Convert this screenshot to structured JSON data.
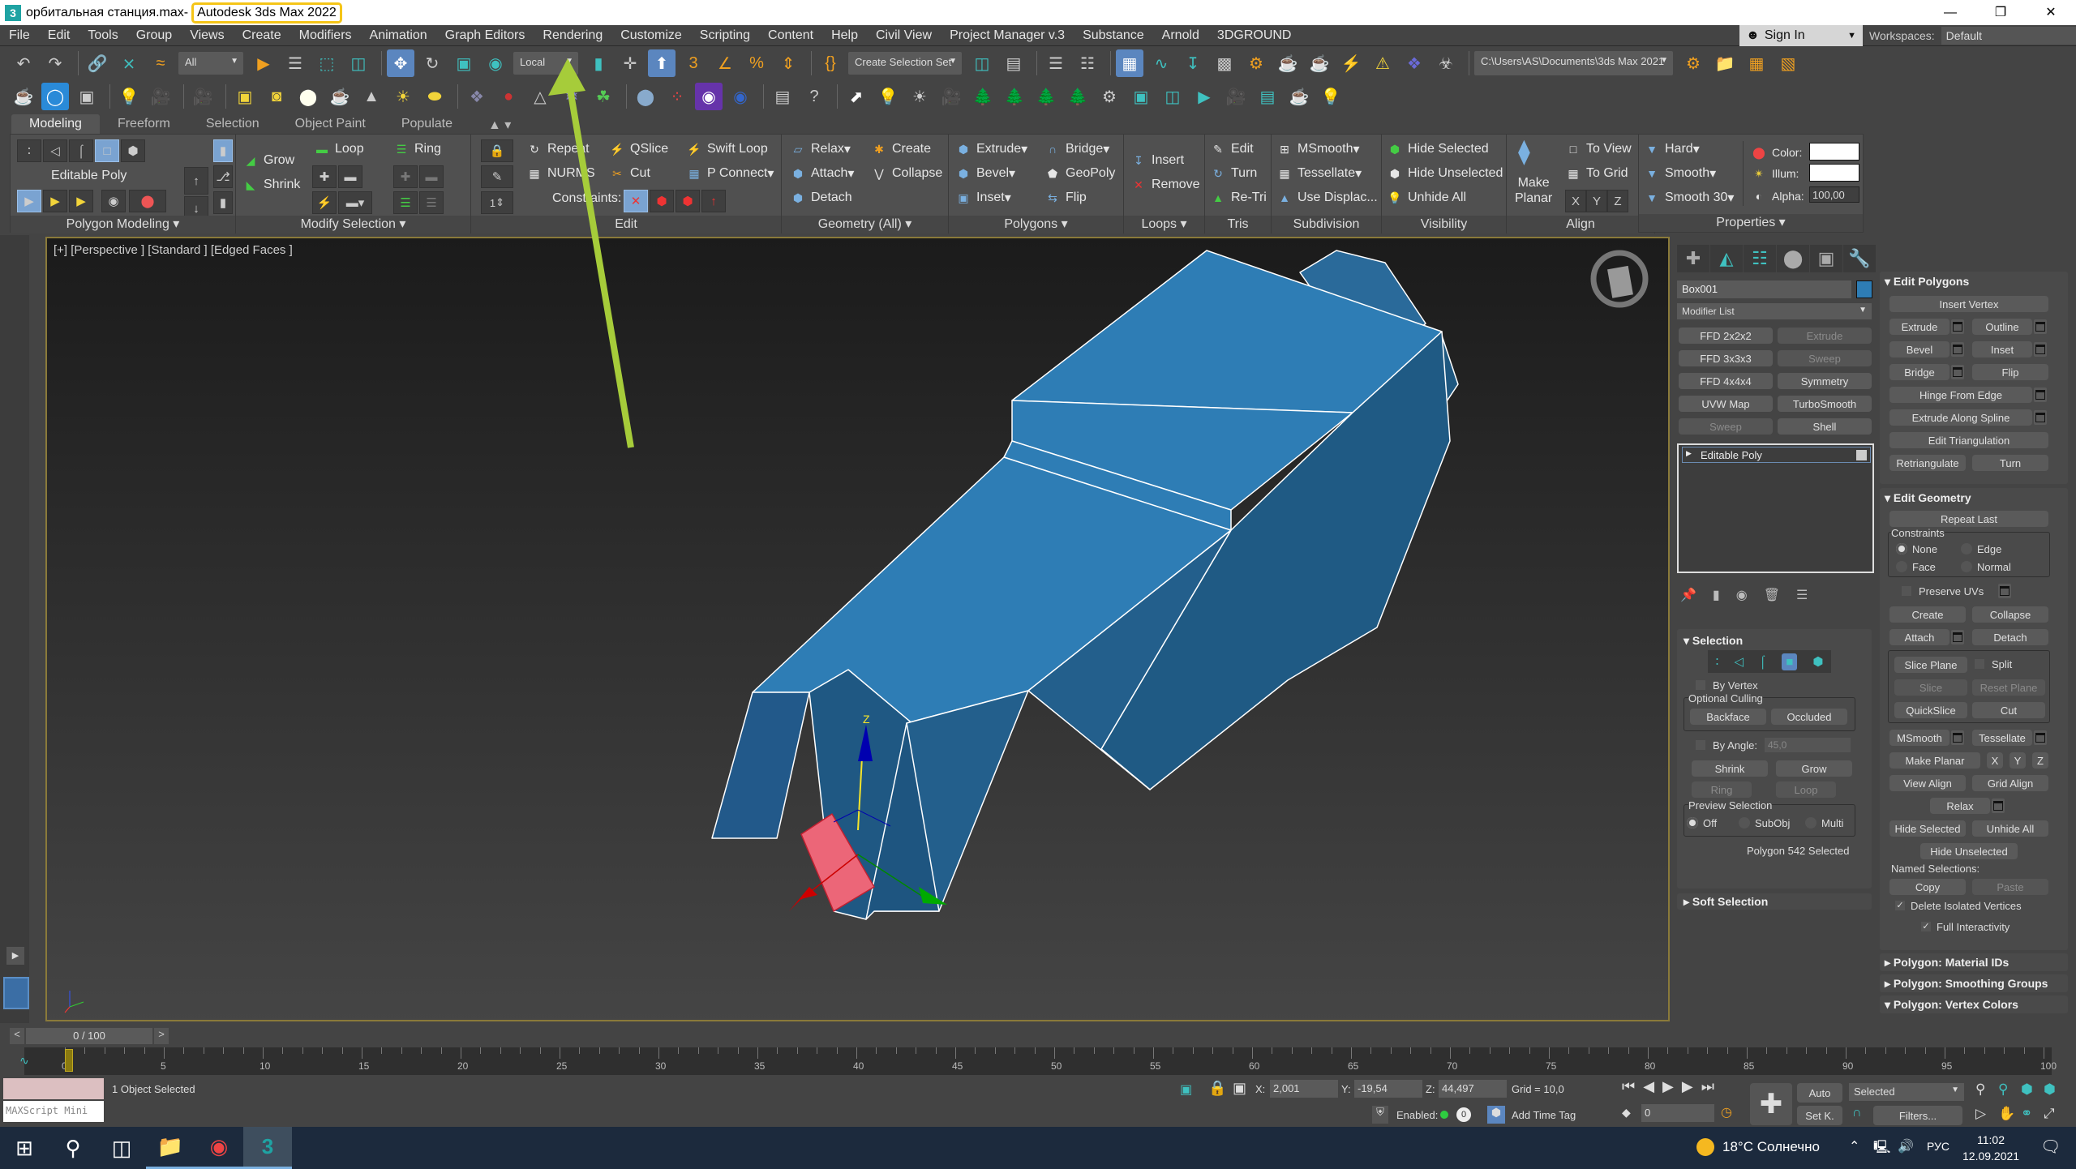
{
  "window": {
    "filename": "орбитальная станция.max",
    "separator": " - ",
    "app": "Autodesk 3ds Max 2022",
    "app_icon": "3ds-max-icon",
    "controls": [
      "minimize",
      "restore",
      "close"
    ]
  },
  "menubar": {
    "items": [
      "File",
      "Edit",
      "Tools",
      "Group",
      "Views",
      "Create",
      "Modifiers",
      "Animation",
      "Graph Editors",
      "Rendering",
      "Customize",
      "Scripting",
      "Content",
      "Help",
      "Civil View",
      "Project Manager v.3",
      "Substance",
      "Arnold",
      "3DGROUND"
    ],
    "signin": "Sign In",
    "workspaces_label": "Workspaces:",
    "workspace": "Default"
  },
  "toolbar1": {
    "selection_filter": "All",
    "ref_coord": "Local",
    "named_selection": "Create Selection Set",
    "project_path": "C:\\Users\\AS\\Documents\\3ds Max 2021"
  },
  "ribbon": {
    "tabs": [
      "Modeling",
      "Freeform",
      "Selection",
      "Object Paint",
      "Populate"
    ],
    "active_tab": "Modeling",
    "object_type": "Editable Poly",
    "groups": {
      "polygon_modeling": "Polygon Modeling",
      "modify_selection": "Modify Selection",
      "edit": "Edit",
      "geometry": "Geometry (All)",
      "polygons": "Polygons",
      "loops": "Loops",
      "tris": "Tris",
      "subdivision": "Subdivision",
      "visibility": "Visibility",
      "align": "Align",
      "properties": "Properties"
    },
    "modify_selection": {
      "grow": "Grow",
      "shrink": "Shrink",
      "loop": "Loop",
      "ring": "Ring"
    },
    "edit": {
      "repeat": "Repeat",
      "qslice": "QSlice",
      "swift_loop": "Swift Loop",
      "nurms": "NURMS",
      "cut": "Cut",
      "p_connect": "P Connect",
      "constraints": "Constraints:",
      "spinner": "1"
    },
    "geometry": {
      "relax": "Relax",
      "create": "Create",
      "attach": "Attach",
      "collapse": "Collapse",
      "detach": "Detach"
    },
    "polygons": {
      "extrude": "Extrude",
      "bridge": "Bridge",
      "bevel": "Bevel",
      "geopoly": "GeoPoly",
      "inset": "Inset",
      "flip": "Flip"
    },
    "loops": {
      "insert": "Insert",
      "remove": "Remove"
    },
    "tris": {
      "edit": "Edit",
      "turn": "Turn",
      "retri": "Re-Tri"
    },
    "subdivision": {
      "msmooth": "MSmooth",
      "tessellate": "Tessellate",
      "use_displac": "Use Displac..."
    },
    "visibility": {
      "hide_selected": "Hide Selected",
      "hide_unselected": "Hide Unselected",
      "unhide_all": "Unhide All"
    },
    "align": {
      "make": "Make",
      "planar": "Planar",
      "to_view": "To View",
      "to_grid": "To Grid",
      "x": "X",
      "y": "Y",
      "z": "Z"
    },
    "properties": {
      "hard": "Hard",
      "smooth": "Smooth",
      "smooth30": "Smooth 30",
      "color": "Color:",
      "illum": "Illum:",
      "alpha": "Alpha:",
      "alpha_value": "100,00",
      "color_value": "#ffffff",
      "illum_value": "#ffffff"
    }
  },
  "viewport": {
    "label": "[+] [Perspective ] [Standard ] [Edged Faces ]",
    "object_color": "#2e7db5",
    "selected_face_color": "#ec6678",
    "gizmo": {
      "x": "X",
      "y": "Y",
      "z": "Z"
    },
    "annotation_arrow_color": "#a6cc3a"
  },
  "command_panel": {
    "tabs": [
      "create",
      "modify",
      "hierarchy",
      "motion",
      "display",
      "utilities"
    ],
    "active_tab": "modify",
    "object_name": "Box001",
    "object_color": "#2e7db5",
    "modifier_list": "Modifier List",
    "modifier_buttons": [
      {
        "label": "FFD 2x2x2",
        "enabled": true
      },
      {
        "label": "Extrude",
        "enabled": false
      },
      {
        "label": "FFD 3x3x3",
        "enabled": true
      },
      {
        "label": "Sweep",
        "enabled": false
      },
      {
        "label": "FFD 4x4x4",
        "enabled": true
      },
      {
        "label": "Symmetry",
        "enabled": true
      },
      {
        "label": "UVW Map",
        "enabled": true
      },
      {
        "label": "TurboSmooth",
        "enabled": true
      },
      {
        "label": "Sweep",
        "enabled": false
      },
      {
        "label": "Shell",
        "enabled": true
      }
    ],
    "stack": [
      "Editable Poly"
    ],
    "selection": {
      "title": "Selection",
      "by_vertex": "By Vertex",
      "optional_culling": "Optional Culling",
      "backface": "Backface",
      "occluded": "Occluded",
      "by_angle": "By Angle:",
      "angle_value": "45,0",
      "shrink": "Shrink",
      "grow": "Grow",
      "ring": "Ring",
      "loop": "Loop",
      "preview_selection": "Preview Selection",
      "preview_options": [
        "Off",
        "SubObj",
        "Multi"
      ],
      "preview_selected": "Off",
      "status": "Polygon 542 Selected"
    },
    "soft_selection": "Soft Selection",
    "edit_polygons": {
      "title": "Edit Polygons",
      "insert_vertex": "Insert Vertex",
      "extrude": "Extrude",
      "outline": "Outline",
      "bevel": "Bevel",
      "inset": "Inset",
      "bridge": "Bridge",
      "flip": "Flip",
      "hinge": "Hinge From Edge",
      "extrude_spline": "Extrude Along Spline",
      "edit_tri": "Edit Triangulation",
      "retriangulate": "Retriangulate",
      "turn": "Turn"
    },
    "edit_geometry": {
      "title": "Edit Geometry",
      "repeat_last": "Repeat Last",
      "constraints": "Constraints",
      "constraint_options": [
        "None",
        "Edge",
        "Face",
        "Normal"
      ],
      "constraint_selected": "None",
      "preserve_uvs": "Preserve UVs",
      "create": "Create",
      "collapse": "Collapse",
      "attach": "Attach",
      "detach": "Detach",
      "slice_plane": "Slice Plane",
      "split": "Split",
      "slice": "Slice",
      "reset_plane": "Reset Plane",
      "quickslice": "QuickSlice",
      "cut": "Cut",
      "msmooth": "MSmooth",
      "tessellate": "Tessellate",
      "make_planar": "Make Planar",
      "x": "X",
      "y": "Y",
      "z": "Z",
      "view_align": "View Align",
      "grid_align": "Grid Align",
      "relax": "Relax",
      "hide_selected": "Hide Selected",
      "unhide_all": "Unhide All",
      "hide_unselected": "Hide Unselected",
      "named_selections": "Named Selections:",
      "copy": "Copy",
      "paste": "Paste",
      "delete_isolated": "Delete Isolated Vertices",
      "full_interactivity": "Full Interactivity"
    },
    "collapsed_rollouts": [
      "Polygon: Material IDs",
      "Polygon: Smoothing Groups",
      "Polygon: Vertex Colors"
    ]
  },
  "timeline": {
    "frame": "0 / 100",
    "ticks": [
      "0",
      "5",
      "10",
      "15",
      "20",
      "25",
      "30",
      "35",
      "40",
      "45",
      "50",
      "55",
      "60",
      "65",
      "70",
      "75",
      "80",
      "85",
      "90",
      "95",
      "100"
    ]
  },
  "status": {
    "maxscript": "MAXScript Mini",
    "message": "1 Object Selected",
    "x_label": "X:",
    "x": "2,001",
    "y_label": "Y:",
    "y": "-19,54",
    "z_label": "Z:",
    "z": "44,497",
    "grid": "Grid = 10,0",
    "enabled": "Enabled:",
    "add_time_tag": "Add Time Tag",
    "auto": "Auto",
    "set_key": "Set K.",
    "key_filter": "Selected",
    "filters": "Filters...",
    "current_frame": "0"
  },
  "taskbar": {
    "weather": "18°C  Солнечно",
    "lang": "РУС",
    "time": "11:02",
    "date": "12.09.2021"
  }
}
